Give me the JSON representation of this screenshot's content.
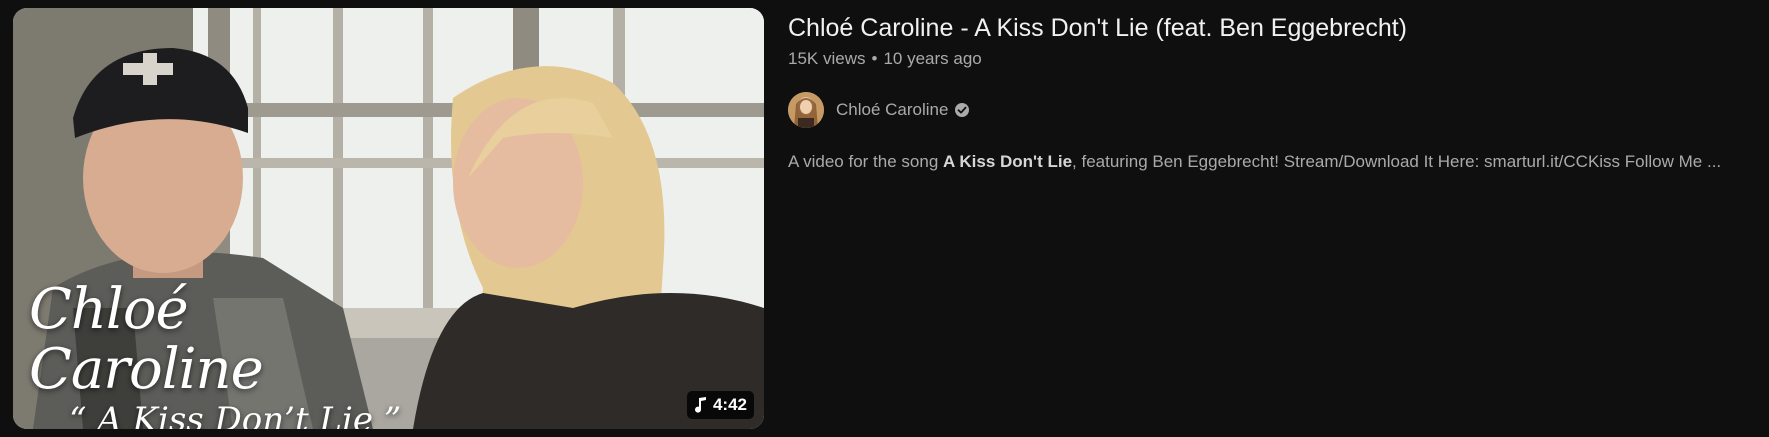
{
  "video": {
    "title": "Chloé Caroline - A Kiss Don't Lie (feat. Ben Eggebrecht)",
    "views": "15K views",
    "separator": "•",
    "age": "10 years ago",
    "duration": "4:42",
    "duration_icon": "music-note-icon"
  },
  "thumbnail": {
    "overlay_artist": "Chloé Caroline",
    "overlay_song": "“ A Kiss Don’t Lie ”"
  },
  "channel": {
    "name": "Chloé Caroline",
    "verified_icon": "verified-check-icon"
  },
  "description": {
    "prefix": "A video for the song ",
    "bold": "A Kiss Don't Lie",
    "suffix": ", featuring Ben Eggebrecht! Stream/Download It Here: smarturl.it/CCKiss Follow Me ..."
  },
  "colors": {
    "background": "#0f0f0f",
    "title": "#f1f1f1",
    "secondary_text": "#aaaaaa"
  }
}
